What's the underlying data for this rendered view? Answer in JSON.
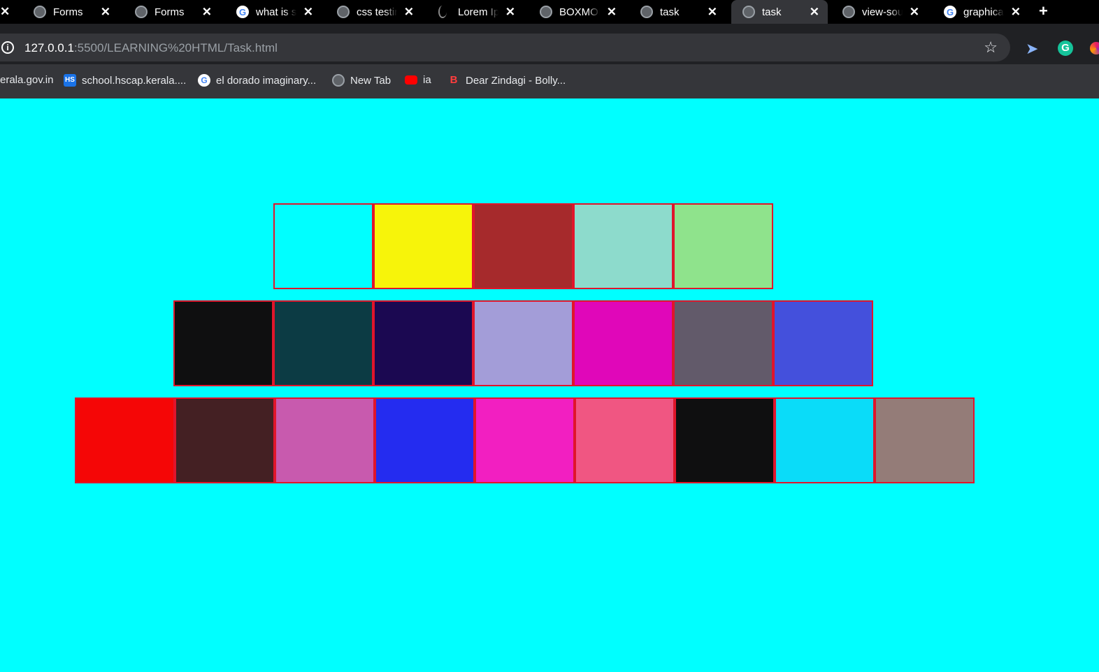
{
  "tabs": [
    {
      "title": "",
      "icon": "close-icon",
      "active": false
    },
    {
      "title": "Forms",
      "icon": "globe-icon",
      "active": false
    },
    {
      "title": "Forms",
      "icon": "globe-icon",
      "active": false
    },
    {
      "title": "what is s",
      "icon": "google-icon",
      "active": false
    },
    {
      "title": "css testir",
      "icon": "globe-icon",
      "active": false
    },
    {
      "title": "Lorem Ip",
      "icon": "lorem-icon",
      "active": false
    },
    {
      "title": "BOXMOI",
      "icon": "globe-icon",
      "active": false
    },
    {
      "title": "task",
      "icon": "globe-icon",
      "active": false
    },
    {
      "title": "task",
      "icon": "globe-icon",
      "active": true
    },
    {
      "title": "view-sou",
      "icon": "globe-icon",
      "active": false
    },
    {
      "title": "graphica",
      "icon": "google-icon",
      "active": false
    }
  ],
  "address": {
    "host": "127.0.0.1",
    "path": ":5500/LEARNING%20HTML/Task.html"
  },
  "bookmarks": [
    {
      "label": "erala.gov.in",
      "icon": "none"
    },
    {
      "label": "school.hscap.kerala....",
      "icon": "hs-icon"
    },
    {
      "label": "el dorado imaginary...",
      "icon": "google-icon"
    },
    {
      "label": "New Tab",
      "icon": "globe-icon"
    },
    {
      "label": "ia",
      "icon": "youtube-icon"
    },
    {
      "label": "Dear Zindagi - Bolly...",
      "icon": "dz-icon"
    }
  ],
  "page": {
    "background": "#00ffff",
    "border_color": "#e0152b",
    "rows": [
      [
        "#00ffff",
        "#f7f40a",
        "#a62a2c",
        "#8ddbcc",
        "#8fe38c"
      ],
      [
        "#0f0f10",
        "#0c3b44",
        "#1b0851",
        "#a39dd8",
        "#e007b9",
        "#625a6a",
        "#4450dc"
      ],
      [
        "#f50606",
        "#442023",
        "#c85aae",
        "#242cf0",
        "#f21fc1",
        "#f05682",
        "#0f0f10",
        "#0adcf9",
        "#947c78"
      ]
    ]
  }
}
